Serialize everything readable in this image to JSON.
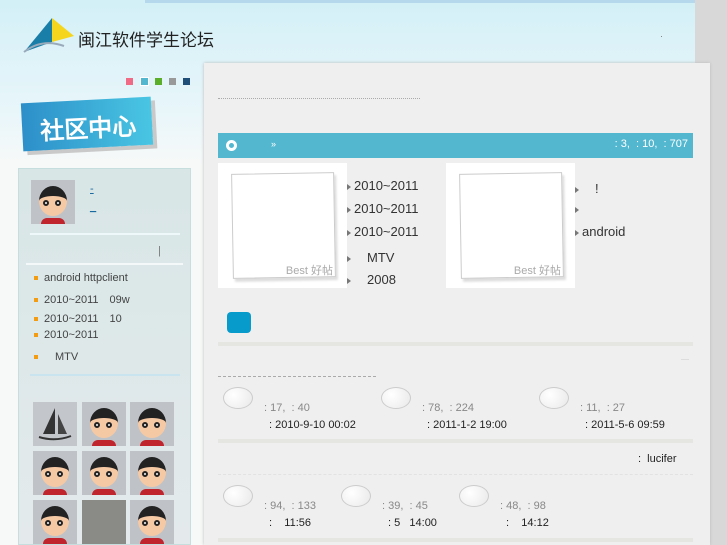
{
  "header": {
    "site_name": "闽江软件学生论坛",
    "dot": "·",
    "banner_title": "社区中心",
    "theme_colors": [
      "#f06a86",
      "#53b7d0",
      "#5aae2a",
      "#999999",
      "#1f4e79"
    ]
  },
  "sidebar": {
    "user_links": [
      "-",
      "_"
    ],
    "divider_mark": "|",
    "recent": [
      "android httpclient",
      "2010~2011　09w",
      "2010~2011　10",
      "2010~2011",
      "　MTV"
    ]
  },
  "forum_bar": {
    "arrow": "»",
    "stats": ": 3,  : 10,  : 707",
    "color": "#53b7d0"
  },
  "best_posts": {
    "badge": "Best 好帖",
    "left_list": [
      "2010~2011",
      "2010~2011",
      "2010~2011",
      "　MTV",
      "　2008"
    ],
    "right_list": [
      "　!",
      "",
      "android"
    ]
  },
  "section1": {
    "items": [
      {
        "stats": ": 17,  : 40",
        "time": ": 2010-9-10 00:02"
      },
      {
        "stats": ": 78,  : 224",
        "time": ": 2011-1-2 19:00"
      },
      {
        "stats": ": 11,  : 27",
        "time": ": 2011-5-6 09:59"
      }
    ]
  },
  "section2": {
    "moderator": ":  lucifer",
    "items": [
      {
        "stats": ": 94,  : 133",
        "time": ":    11:56"
      },
      {
        "stats": ": 39,  : 45",
        "time": ": 5   14:00"
      },
      {
        "stats": ": 48,  : 98",
        "time": ":    14:12"
      }
    ]
  }
}
